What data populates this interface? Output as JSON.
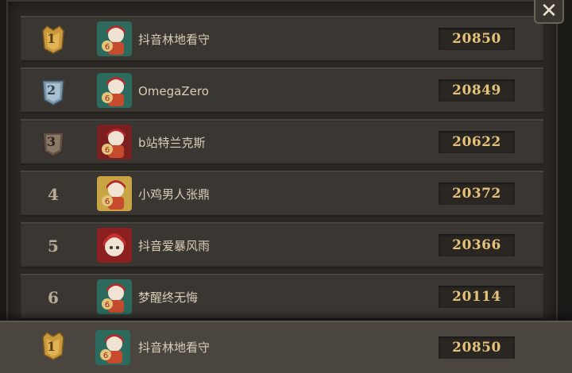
{
  "close_icon_glyph": "✕",
  "rows": [
    {
      "rank": "1",
      "rank_style": "gold",
      "avatar_color": "teal",
      "name": "抖音林地看守",
      "score": "20850"
    },
    {
      "rank": "2",
      "rank_style": "silver",
      "avatar_color": "teal",
      "name": "OmegaZero",
      "score": "20849"
    },
    {
      "rank": "3",
      "rank_style": "bronze",
      "avatar_color": "red",
      "name": "b站特兰克斯",
      "score": "20622"
    },
    {
      "rank": "4",
      "rank_style": "plain",
      "avatar_color": "gold",
      "name": "小鸡男人张鼎",
      "score": "20372"
    },
    {
      "rank": "5",
      "rank_style": "plain",
      "avatar_color": "red",
      "name": "抖音爱暴风雨",
      "score": "20366"
    },
    {
      "rank": "6",
      "rank_style": "plain",
      "avatar_color": "teal",
      "name": "梦醒终无悔",
      "score": "20114"
    }
  ],
  "self_row": {
    "rank": "1",
    "rank_style": "gold",
    "avatar_color": "teal",
    "name": "抖音林地看守",
    "score": "20850"
  },
  "colors": {
    "gold": "#c9993c",
    "silver": "#7b97aa",
    "bronze": "#7e6a58",
    "score": "#e4c27a",
    "name": "#d8cdb9"
  }
}
